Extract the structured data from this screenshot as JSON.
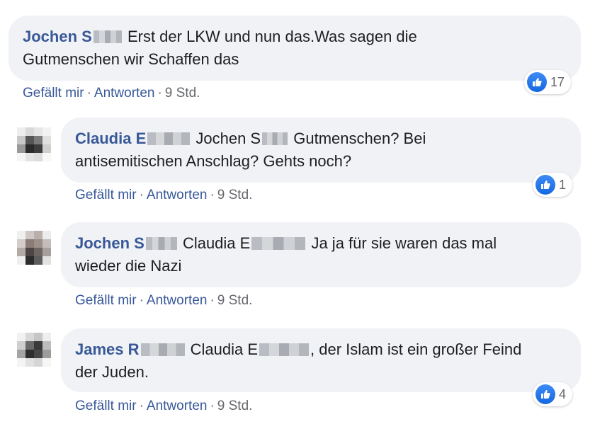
{
  "comments": [
    {
      "author": "Jochen S",
      "text_line1": "Erst der LKW und nun das.Was sagen die",
      "text_line2": "Gutmenschen wir Schaffen das",
      "like": "Gefällt mir",
      "reply": "Antworten",
      "time": "9 Std.",
      "reactions": "17"
    },
    {
      "author": "Claudia E",
      "mention": "Jochen S",
      "text_line1": "Gutmenschen? Bei",
      "text_line2": "antisemitischen Anschlag? Gehts noch?",
      "like": "Gefällt mir",
      "reply": "Antworten",
      "time": "9 Std.",
      "reactions": "1"
    },
    {
      "author": "Jochen S",
      "mention": "Claudia E",
      "text_line1": "Ja ja für sie waren das mal",
      "text_line2": "wieder die Nazi",
      "like": "Gefällt mir",
      "reply": "Antworten",
      "time": "9 Std."
    },
    {
      "author": "James R",
      "mention": "Claudia E",
      "text_line1": ", der Islam ist ein großer Feind",
      "text_line2": "der Juden.",
      "like": "Gefällt mir",
      "reply": "Antworten",
      "time": "9 Std.",
      "reactions": "4"
    }
  ],
  "separator": "·",
  "colors": {
    "author": "#385898",
    "bubble": "#f0f2f5",
    "meta": "#65676b",
    "like_blue": "#1877f2"
  },
  "icons": {
    "reaction": "like-thumb-icon"
  }
}
